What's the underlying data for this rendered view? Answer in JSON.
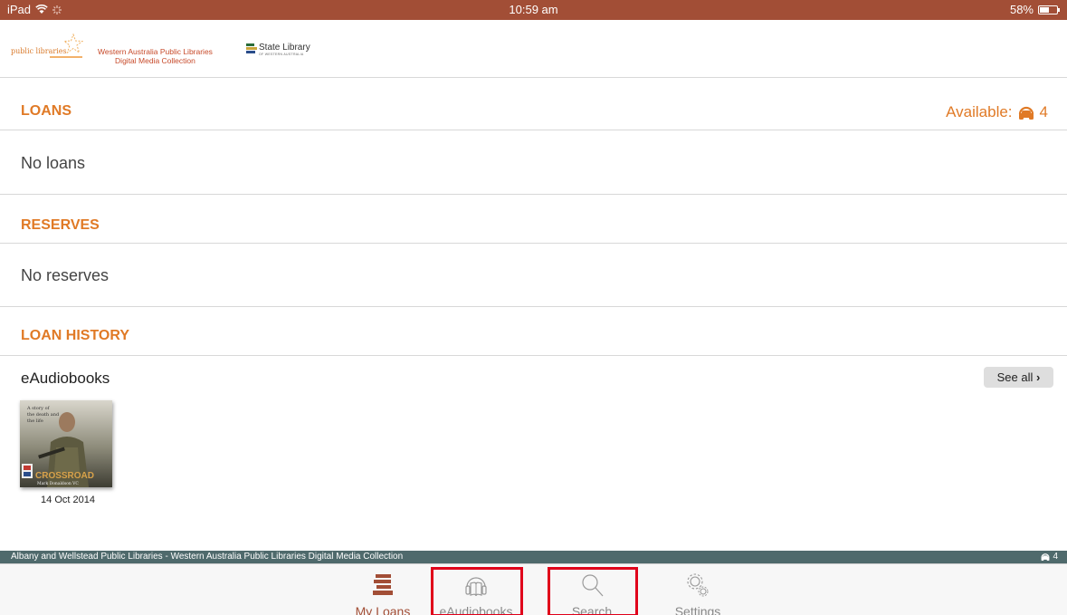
{
  "status_bar": {
    "device": "iPad",
    "time": "10:59 am",
    "battery_percent": "58%",
    "battery_level": 0.58
  },
  "header": {
    "public_libraries_logo_text": "public libraries",
    "wa_title_line1": "Western Australia Public Libraries",
    "wa_title_line2": "Digital Media Collection",
    "state_library_text": "State Library",
    "state_library_sub": "OF WESTERN AUSTRALIA"
  },
  "loans": {
    "title": "LOANS",
    "available_label": "Available:",
    "available_count": "4",
    "empty_text": "No loans"
  },
  "reserves": {
    "title": "RESERVES",
    "empty_text": "No reserves"
  },
  "loan_history": {
    "title": "LOAN HISTORY",
    "category_label": "eAudiobooks",
    "see_all_label": "See all",
    "items": [
      {
        "cover_title": "CROSSROAD",
        "cover_author": "Mark Donaldson VC",
        "date": "14 Oct 2014"
      }
    ]
  },
  "footer": {
    "banner_text": "Albany and Wellstead Public Libraries - Western Australia Public Libraries Digital Media Collection",
    "banner_count": "4"
  },
  "tab_bar": {
    "tabs": [
      {
        "label": "My Loans",
        "icon": "books-stack-icon",
        "active": true
      },
      {
        "label": "eAudiobooks",
        "icon": "headphones-book-icon",
        "active": false
      },
      {
        "label": "Search",
        "icon": "magnifier-icon",
        "active": false
      },
      {
        "label": "Settings",
        "icon": "gears-icon",
        "active": false
      }
    ]
  },
  "colors": {
    "status_bar": "#a24e36",
    "accent_orange": "#e07a26",
    "footer_banner": "#4f6a6c",
    "highlight": "#e0001a"
  }
}
